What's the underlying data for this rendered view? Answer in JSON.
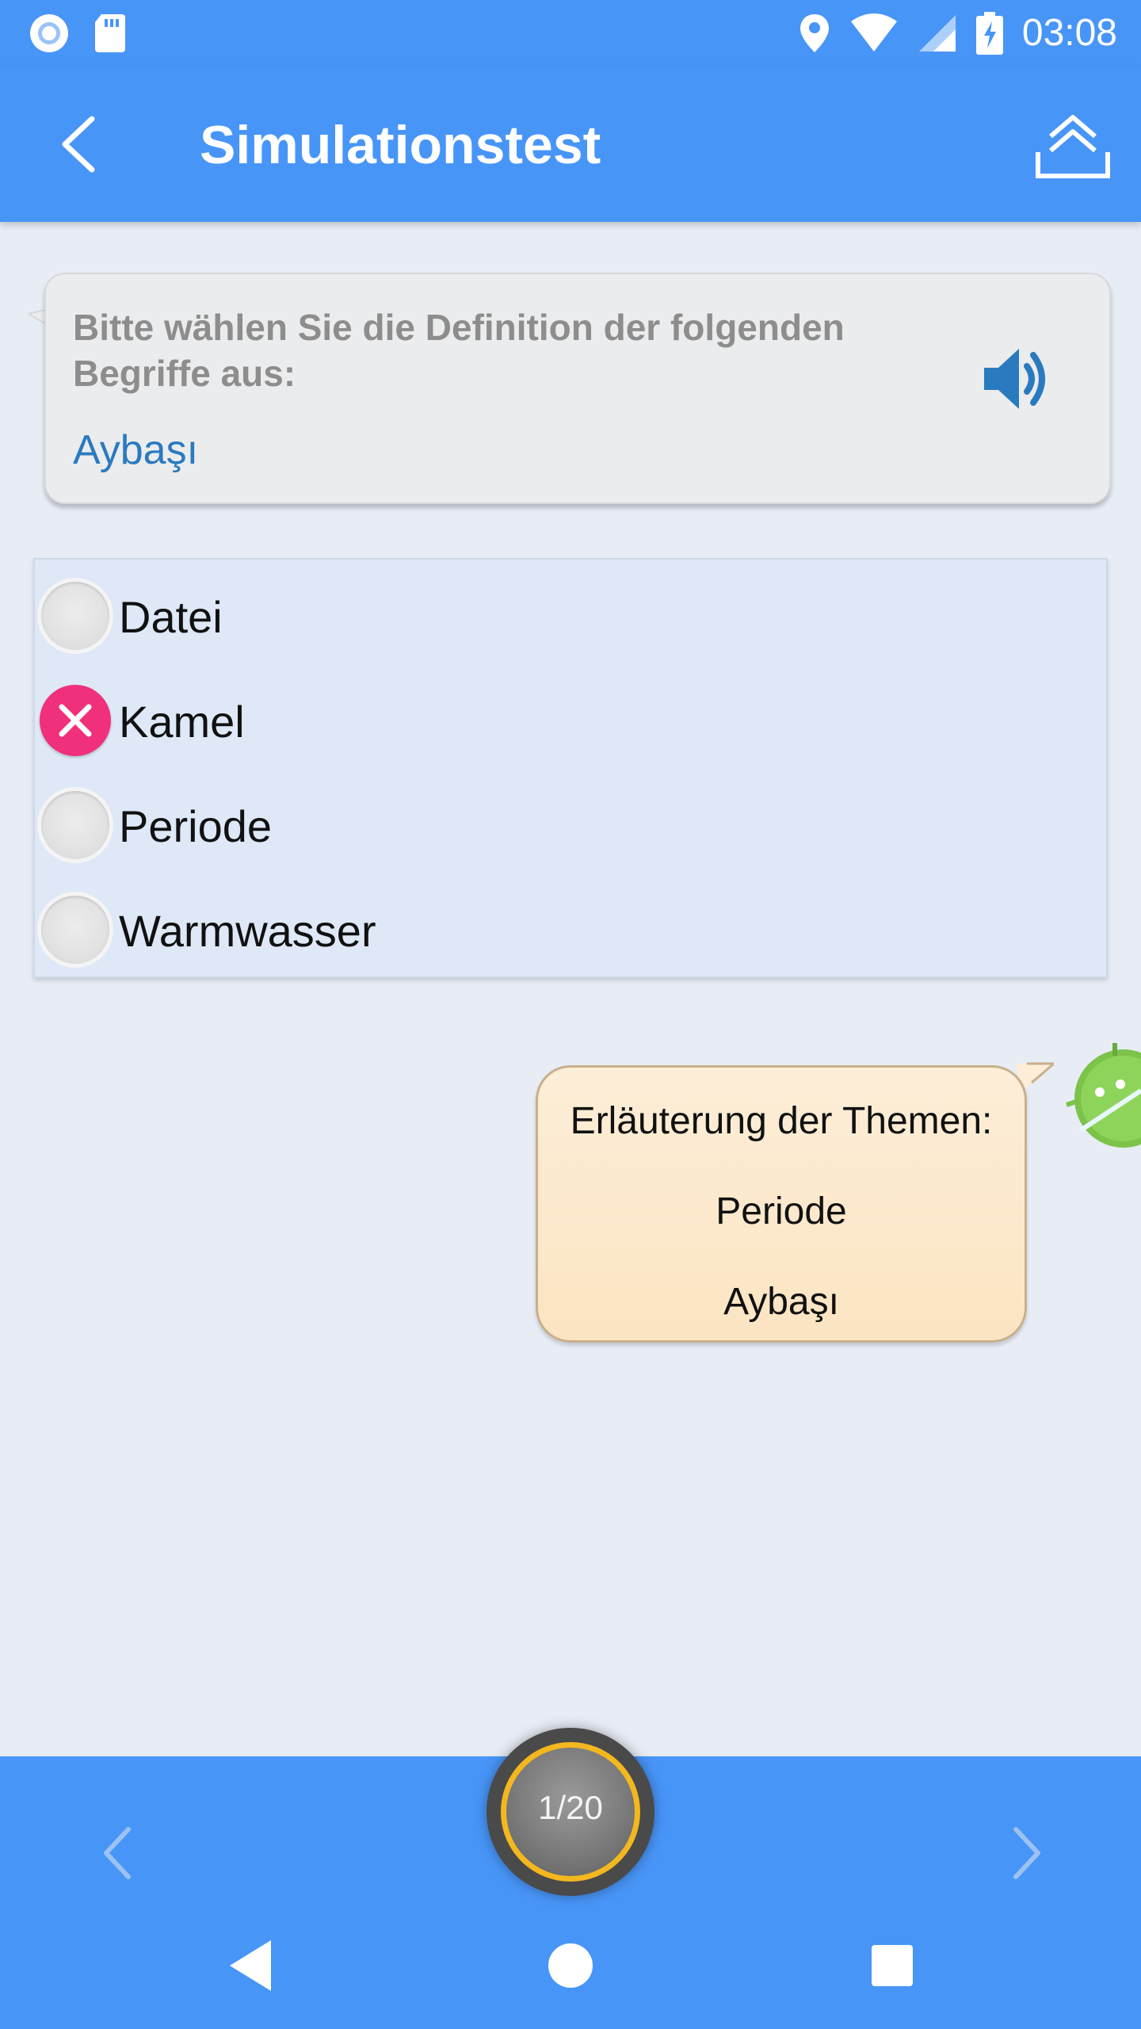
{
  "status_bar": {
    "time": "03:08",
    "icons": [
      "record-icon",
      "sd-card-icon",
      "location-icon",
      "wifi-icon",
      "signal-icon",
      "battery-charging-icon"
    ]
  },
  "app_bar": {
    "title": "Simulationstest",
    "back_icon": "chevron-left-icon",
    "share_icon": "upload-share-icon"
  },
  "question": {
    "prompt": "Bitte wählen Sie die Definition der folgenden Begriffe aus:",
    "term": "Aybaşı",
    "speaker_icon": "speaker-icon"
  },
  "options": [
    {
      "label": "Datei",
      "state": "unselected"
    },
    {
      "label": "Kamel",
      "state": "wrong"
    },
    {
      "label": "Periode",
      "state": "unselected"
    },
    {
      "label": "Warmwasser",
      "state": "unselected"
    }
  ],
  "explanation": {
    "heading": "Erläuterung der Themen:",
    "answer": "Periode",
    "term": "Aybaşı"
  },
  "pager": {
    "counter": "1/20",
    "prev_icon": "chevron-left-icon",
    "next_icon": "chevron-right-icon"
  },
  "colors": {
    "primary": "#4895f8",
    "wrong": "#f0307a",
    "term": "#2a7ac0",
    "counter_ring": "#f3b71f"
  }
}
